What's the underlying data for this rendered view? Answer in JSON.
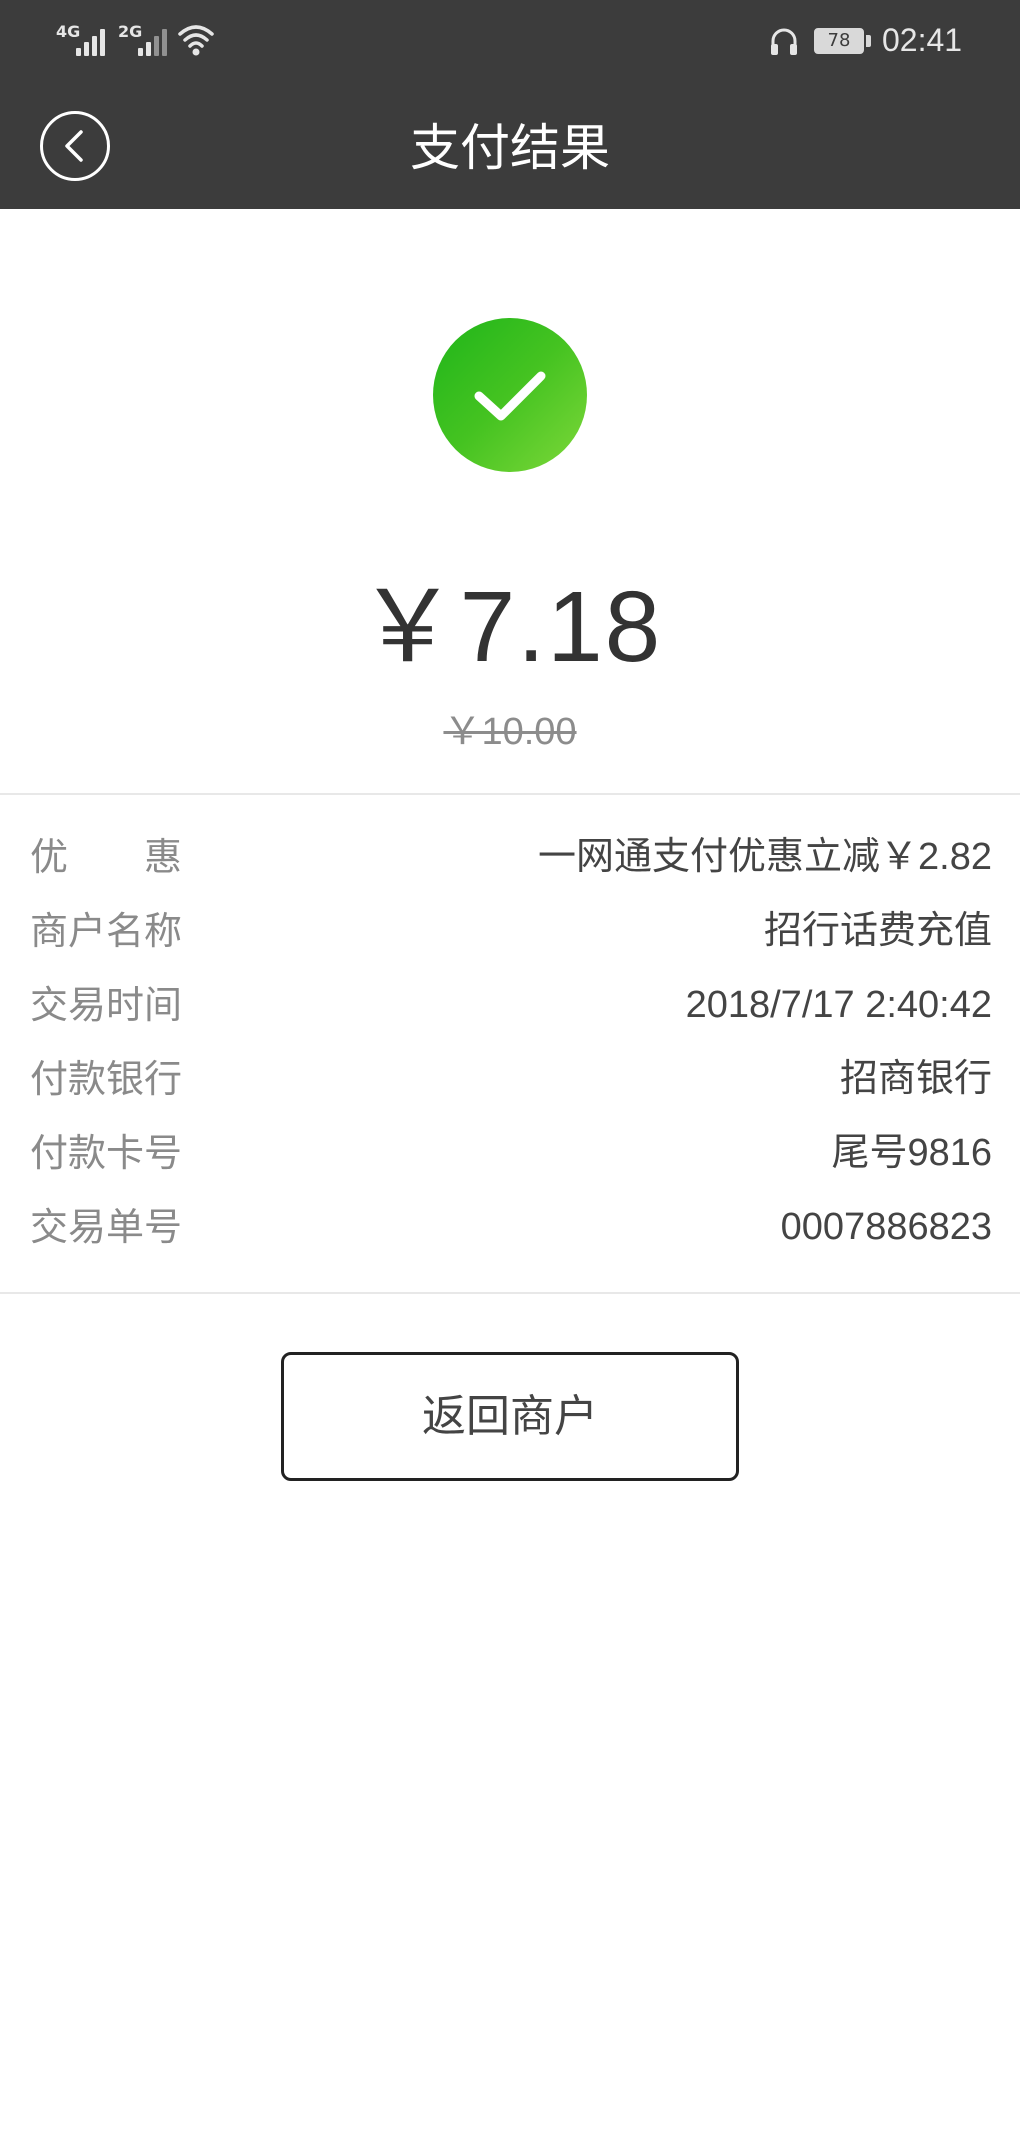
{
  "status_bar": {
    "network_1": "4G",
    "network_2": "2G",
    "battery": "78",
    "time": "02:41"
  },
  "nav": {
    "title": "支付结果",
    "back_icon": "chevron-left-circle-icon"
  },
  "result": {
    "icon": "check-circle-icon",
    "icon_color": "#3fc023",
    "amount": "￥7.18",
    "original_amount": "￥10.00"
  },
  "details": [
    {
      "label": "优　　惠",
      "value": "一网通支付优惠立减￥2.82"
    },
    {
      "label": "商户名称",
      "value": "招行话费充值"
    },
    {
      "label": "交易时间",
      "value": "2018/7/17 2:40:42"
    },
    {
      "label": "付款银行",
      "value": "招商银行"
    },
    {
      "label": "付款卡号",
      "value": "尾号9816"
    },
    {
      "label": "交易单号",
      "value": "0007886823"
    }
  ],
  "actions": {
    "return_label": "返回商户"
  },
  "colors": {
    "header_bg": "#3c3c3c",
    "success_green": "#3fc023"
  }
}
